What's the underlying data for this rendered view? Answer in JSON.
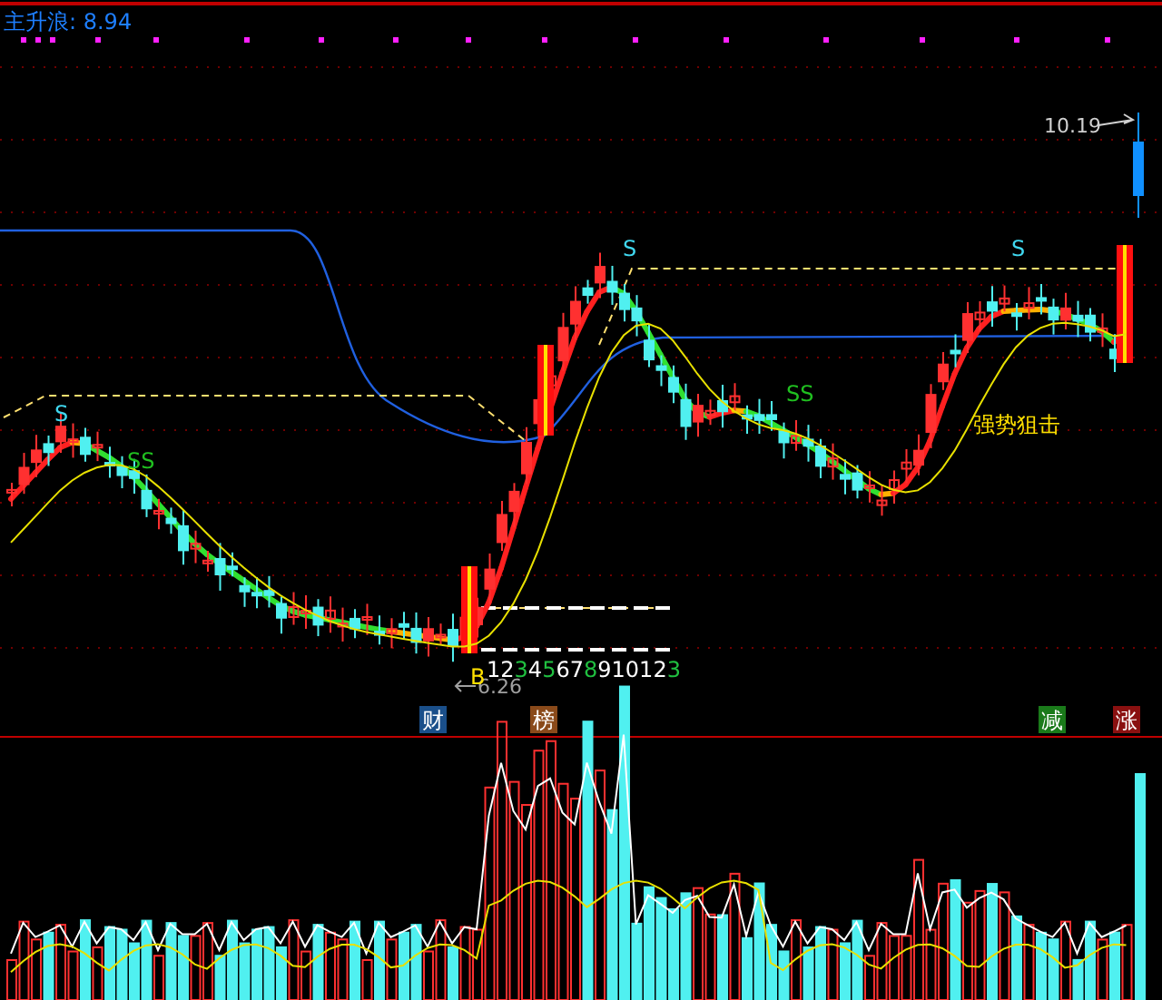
{
  "indicator": {
    "label": "主升浪: 8.94"
  },
  "price_labels": [
    {
      "text": "10.19",
      "kind": "high"
    },
    {
      "text": "6.26",
      "kind": "low"
    }
  ],
  "signals": [
    {
      "text": "S",
      "color": "#40d8f0"
    },
    {
      "text": "SS",
      "color": "#20c020"
    },
    {
      "text": "S",
      "color": "#40d8f0"
    },
    {
      "text": "SS",
      "color": "#20c020"
    },
    {
      "text": "S",
      "color": "#40d8f0"
    }
  ],
  "callout": "强势狙击",
  "buy_mark": "B",
  "counter": [
    {
      "text": "1",
      "color": "#ffffff"
    },
    {
      "text": "2",
      "color": "#ffffff"
    },
    {
      "text": "3",
      "color": "#20c040"
    },
    {
      "text": "4",
      "color": "#ffffff"
    },
    {
      "text": "5",
      "color": "#20c040"
    },
    {
      "text": "6",
      "color": "#ffffff"
    },
    {
      "text": "7",
      "color": "#ffffff"
    },
    {
      "text": "8",
      "color": "#20c040"
    },
    {
      "text": "9",
      "color": "#ffffff"
    },
    {
      "text": "10",
      "color": "#ffffff"
    },
    {
      "text": "1",
      "color": "#ffffff"
    },
    {
      "text": "2",
      "color": "#ffffff"
    },
    {
      "text": "3",
      "color": "#20c040"
    }
  ],
  "badges": [
    {
      "text": "财",
      "color": "#1a4f8a"
    },
    {
      "text": "榜",
      "color": "#8a4a1a"
    },
    {
      "text": "减",
      "color": "#1a7a1a"
    },
    {
      "text": "涨",
      "color": "#8a1010"
    }
  ]
}
